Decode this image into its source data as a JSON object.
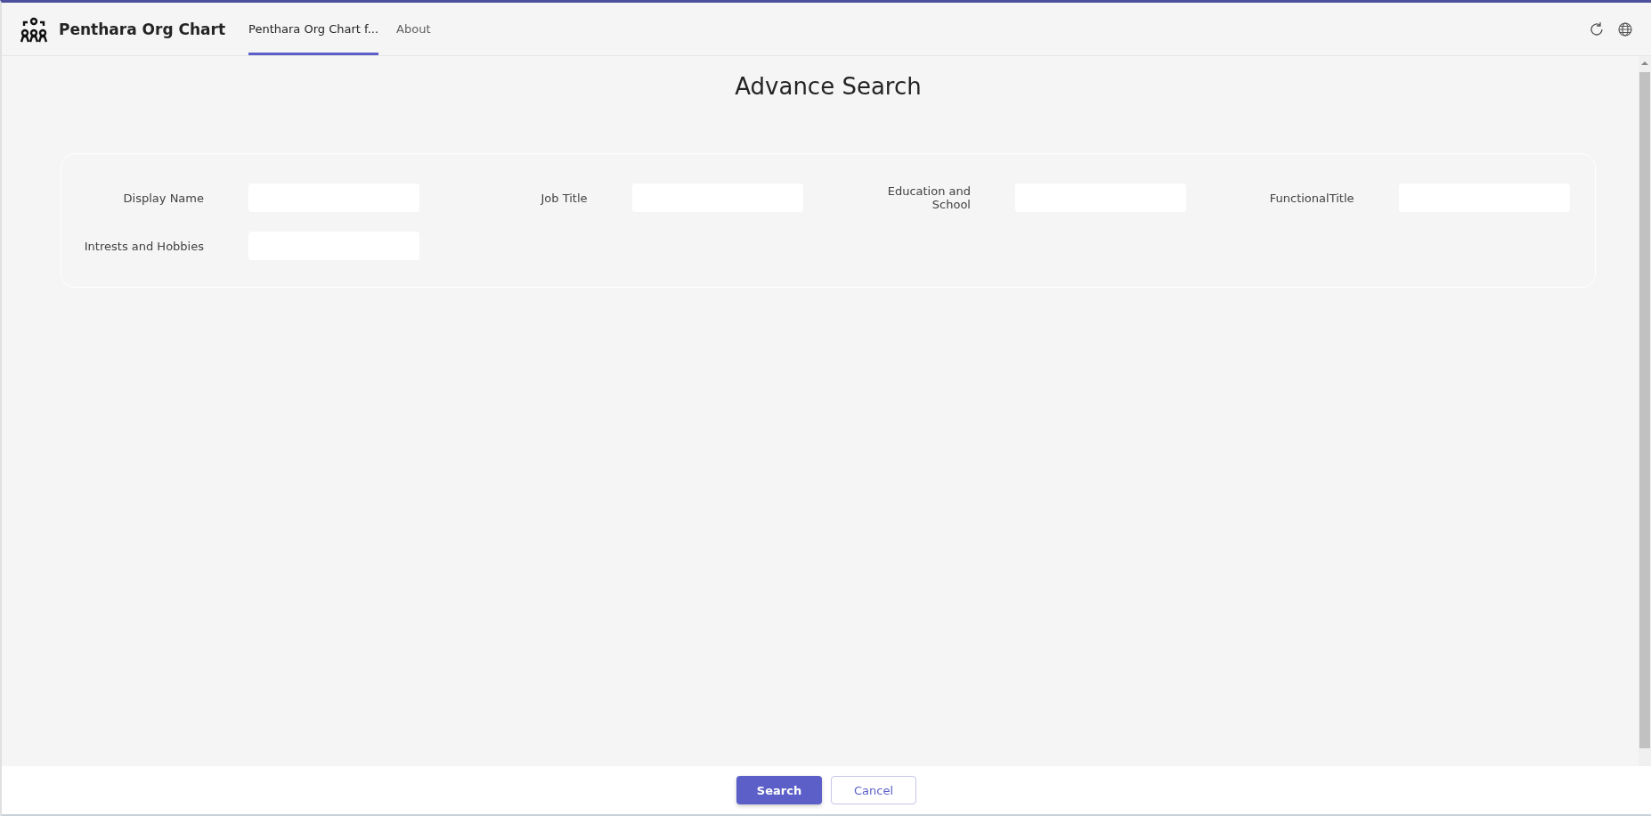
{
  "app": {
    "name": "Penthara Org Chart"
  },
  "tabs": [
    {
      "label": "Penthara Org Chart f...",
      "selected": true
    },
    {
      "label": "About",
      "selected": false
    }
  ],
  "page": {
    "title": "Advance Search"
  },
  "fields": [
    {
      "label": "Display Name"
    },
    {
      "label": "Job Title"
    },
    {
      "label": "Education and School"
    },
    {
      "label": "FunctionalTitle"
    },
    {
      "label": "Intrests and Hobbies"
    }
  ],
  "buttons": [
    {
      "label": "Search",
      "kind": "primary"
    },
    {
      "label": "Cancel",
      "kind": "secondary"
    }
  ]
}
